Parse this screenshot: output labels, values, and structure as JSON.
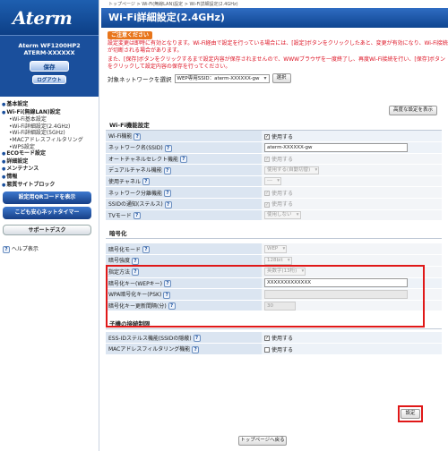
{
  "sidebar": {
    "logo": "Aterm",
    "model": "Aterm WF1200HP2",
    "device_id": "ATERM-XXXXXX",
    "save_label": "保存",
    "logout_label": "ログアウト",
    "menu": [
      {
        "label": "基本設定",
        "type": "h"
      },
      {
        "label": "Wi-Fi(無線LAN)設定",
        "type": "h"
      },
      {
        "label": "•Wi-Fi基本設定",
        "type": "s"
      },
      {
        "label": "•Wi-Fi詳細設定(2.4GHz)",
        "type": "s"
      },
      {
        "label": "•Wi-Fi詳細設定(5GHz)",
        "type": "s"
      },
      {
        "label": "•MACアドレスフィルタリング",
        "type": "s"
      },
      {
        "label": "•WPS設定",
        "type": "s"
      },
      {
        "label": "ECOモード設定",
        "type": "h"
      },
      {
        "label": "詳細設定",
        "type": "h"
      },
      {
        "label": "メンテナンス",
        "type": "h"
      },
      {
        "label": "情報",
        "type": "h"
      },
      {
        "label": "悪質サイトブロック",
        "type": "h"
      }
    ],
    "qr_button": "設定用QRコードを表示",
    "timer_button": "こども安心ネットタイマー",
    "support_button": "サポートデスク",
    "help_label": "ヘルプ表示"
  },
  "main": {
    "breadcrumb": "トップページ > Wi-Fi(無線LAN)設定 > Wi-Fi詳細設定(2.4GHz)",
    "title": "Wi-Fi詳細設定(2.4GHz)",
    "notice_head": "ご注意ください",
    "notice_1": "設定変更は即時に有効となります。Wi-Fi経由で設定を行っている場合には、[設定]ボタンをクリックしたあと、変更が有効になり、Wi-Fi接続が切断される場合があります。",
    "notice_2": "また、[保存]ボタンをクリックするまで設定内容が保存されませんので、WWWブラウザを一度終了し、再度Wi-Fi接続を行い、[保存]ボタンをクリックして設定内容の保存を行ってください。",
    "target_label": "対象ネットワークを選択",
    "target_value": "WEP専用SSID：aterm-XXXXXX-gw",
    "select_button": "選択",
    "detail_button": "高度な設定を表示",
    "sections": {
      "wifi": {
        "title": "Wi-Fi機能設定",
        "rows": [
          {
            "label": "Wi-Fi機能",
            "value": "使用する"
          },
          {
            "label": "ネットワーク名(SSID)",
            "value": "aterm-XXXXXX-gw"
          },
          {
            "label": "オートチャネルセレクト機能",
            "value": "使用する"
          },
          {
            "label": "デュアルチャネル機能",
            "value": "使用する(自動切替)"
          },
          {
            "label": "使用チャネル",
            "value": "---"
          },
          {
            "label": "ネットワーク分離機能",
            "value": "使用する"
          },
          {
            "label": "SSIDの通知(ステルス)",
            "value": "使用する"
          },
          {
            "label": "TVモード",
            "value": "使用しない"
          }
        ]
      },
      "encryption": {
        "title": "暗号化",
        "rows": [
          {
            "label": "暗号化モード",
            "value": "WEP"
          },
          {
            "label": "暗号強度",
            "value": "128bit"
          },
          {
            "label": "指定方法",
            "value": "英数字(13桁)"
          },
          {
            "label": "暗号化キー(WEPキー)",
            "value": "XXXXXXXXXXXXX"
          },
          {
            "label": "WPA暗号化キー(PSK)",
            "value": ""
          },
          {
            "label": "暗号化キー更新間隔(分)",
            "value": "30"
          }
        ]
      },
      "child": {
        "title": "子機の接続制限",
        "rows": [
          {
            "label": "ESS-IDステルス機能(SSIDの隠蔽)",
            "value": "使用する"
          },
          {
            "label": "MACアドレスフィルタリング機能",
            "value": "使用する"
          }
        ]
      }
    },
    "set_button": "設定",
    "top_button": "トップページへ戻る"
  },
  "colors": {
    "accent": "#1a4f9c",
    "highlight": "#e01818",
    "warning": "#d12"
  }
}
